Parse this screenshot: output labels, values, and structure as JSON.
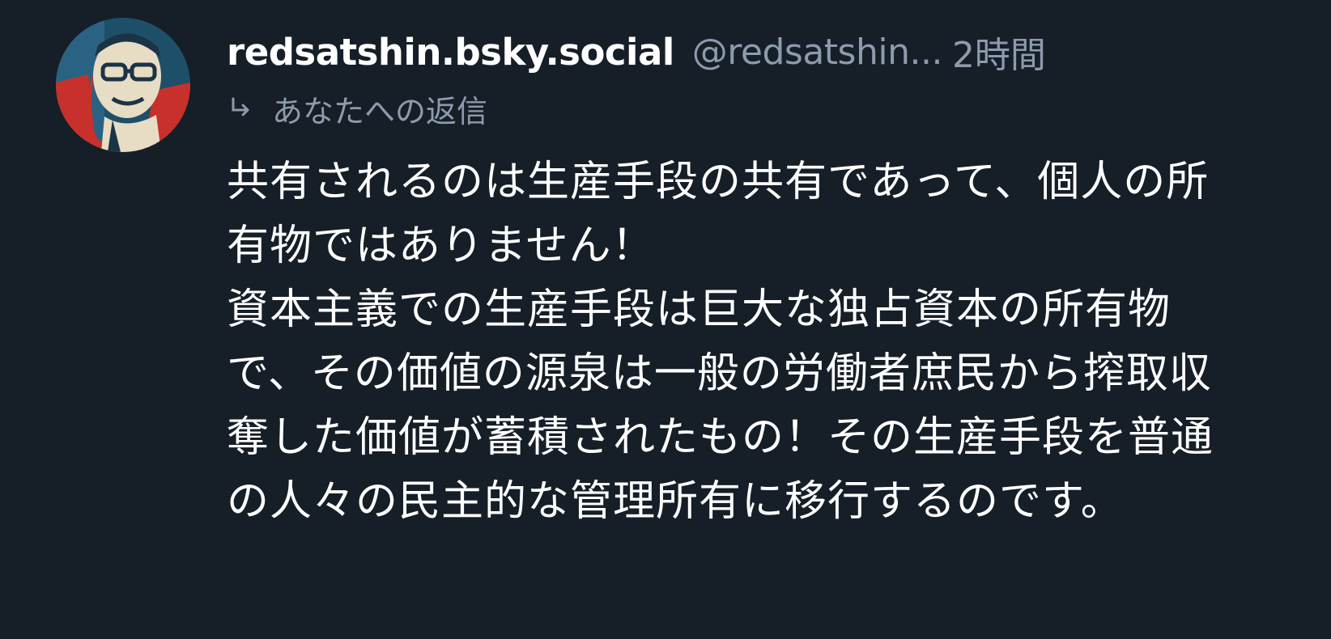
{
  "post": {
    "display_name": "redsatshin.bsky.social",
    "handle": "@redsatshin...",
    "timestamp": "2時間",
    "reply_indicator_icon": "reply-arrow-icon",
    "reply_label": "あなたへの返信",
    "body": "共有されるのは生産手段の共有であって、個人の所有物ではありません！\n資本主義での生産手段は巨大な独占資本の所有物で、その価値の源泉は一般の労働者庶民から搾取収奪した価値が蓄積されたもの！その生産手段を普通の人々の民主的な管理所有に移行するのです。"
  },
  "colors": {
    "background": "#161e27",
    "primary_text": "#ffffff",
    "secondary_text": "#8d9bae"
  }
}
